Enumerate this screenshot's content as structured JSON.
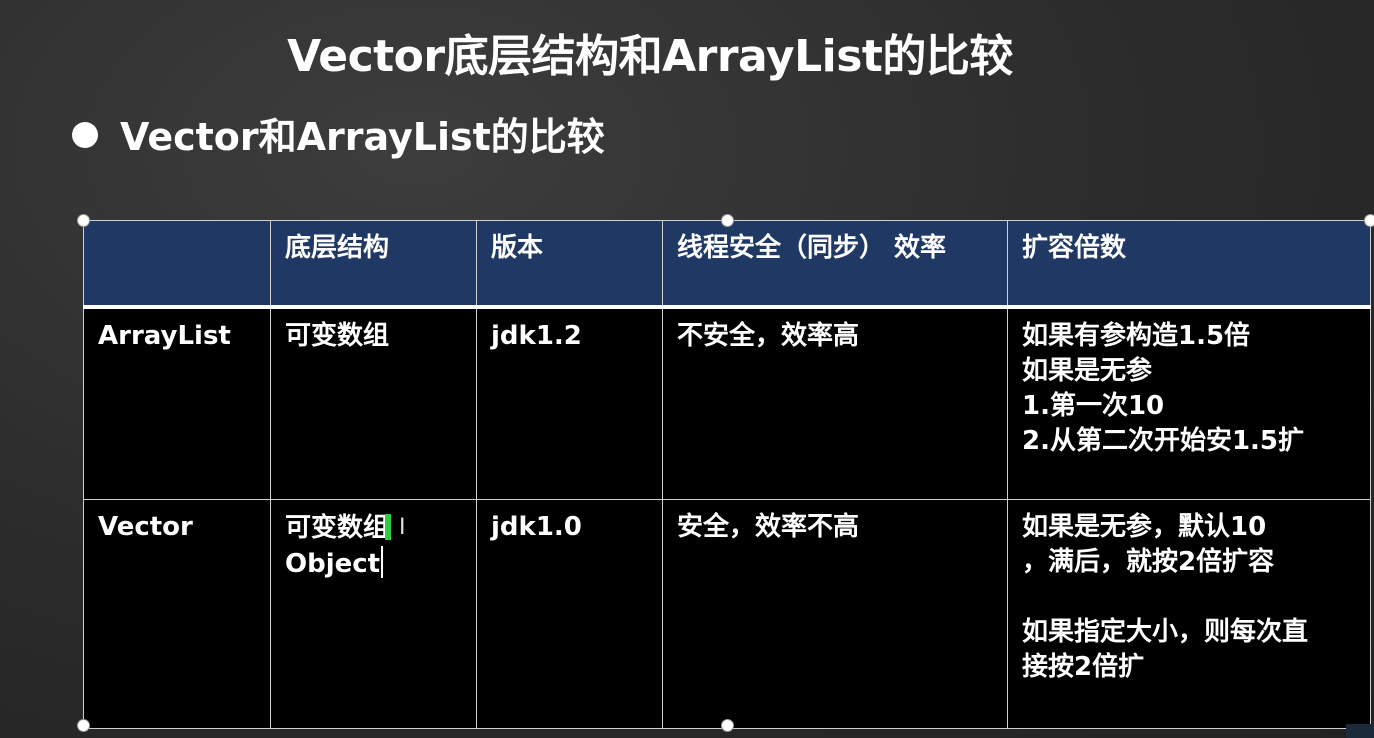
{
  "slide": {
    "title": "Vector底层结构和ArrayList的比较",
    "bullet": "Vector和ArrayList的比较"
  },
  "table": {
    "headers": [
      "",
      "底层结构",
      "版本",
      "线程安全（同步） 效率",
      "扩容倍数"
    ],
    "rows": [
      {
        "name": "ArrayList",
        "structure": [
          "可变数组"
        ],
        "version": "jdk1.2",
        "safety": "不安全，效率高",
        "growth": [
          "如果有参构造1.5倍",
          "如果是无参",
          "1.第一次10",
          "2.从第二次开始安1.5扩"
        ]
      },
      {
        "name": "Vector",
        "structure": [
          "可变数组",
          "Object"
        ],
        "version": "jdk1.0",
        "safety": "安全，效率不高",
        "growth": [
          "如果是无参，默认10",
          "，满后，就按2倍扩容",
          "",
          "如果指定大小，则每次直",
          "接按2倍扩"
        ]
      }
    ]
  },
  "editor": {
    "ibeam_glyph": "I"
  }
}
